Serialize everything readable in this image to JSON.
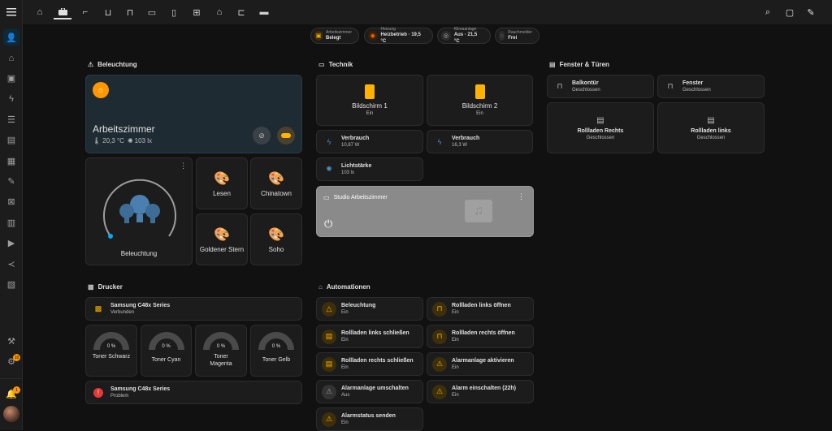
{
  "sidebar": {
    "menu_icon": "menu-icon",
    "items": [
      "person-icon",
      "home-icon",
      "account-box-icon",
      "flash-icon",
      "list-icon",
      "chart-icon",
      "calendar-icon",
      "wrench-icon",
      "hub-icon",
      "server-icon",
      "media-icon",
      "vscode-icon",
      "clipboard-icon"
    ],
    "bottom": [
      "hammer-icon",
      "settings-icon",
      "bell-icon",
      "avatar"
    ],
    "settings_badge": "10",
    "notif_badge": "1"
  },
  "tabs": [
    "home-icon",
    "briefcase-icon",
    "shower-icon",
    "bath-icon",
    "sofa-icon",
    "bed-icon",
    "door-icon",
    "window-icon",
    "garage-icon",
    "car-icon",
    "desk-icon"
  ],
  "top_actions": [
    "search-icon",
    "assist-icon",
    "pencil-icon"
  ],
  "badges": [
    {
      "label": "Arbeitszimmer",
      "value": "Belegt",
      "icon": "briefcase-icon",
      "color": "#ffb300"
    },
    {
      "label": "Heizung",
      "value": "Heizbetrieb · 19,5 °C",
      "icon": "thermostat-icon",
      "color": "#ff6d00"
    },
    {
      "label": "Klimaanlage",
      "value": "Aus · 21,5 °C",
      "icon": "aircon-icon",
      "color": "#9e9e9e"
    },
    {
      "label": "Rauchmelder",
      "value": "Frei",
      "icon": "smoke-icon",
      "color": "#9e9e9e"
    }
  ],
  "sections": {
    "beleuchtung": "Beleuchtung",
    "technik": "Technik",
    "fenster": "Fenster & Türen",
    "drucker": "Drucker",
    "automationen": "Automationen"
  },
  "room": {
    "name": "Arbeitszimmer",
    "temp": "20,3 °C",
    "lux": "103 lx"
  },
  "light_dial": {
    "name": "Beleuchtung"
  },
  "scenes": [
    "Lesen",
    "Chinatown",
    "Goldener Stern",
    "Soho"
  ],
  "technik": {
    "screens": [
      {
        "name": "Bildschirm 1",
        "state": "Ein"
      },
      {
        "name": "Bildschirm 2",
        "state": "Ein"
      }
    ],
    "sensors": [
      {
        "name": "Verbrauch",
        "state": "10,87 W"
      },
      {
        "name": "Verbrauch",
        "state": "16,3 W"
      },
      {
        "name": "Lichtstärke",
        "state": "103 lx"
      }
    ],
    "media": {
      "name": "Studio Arbeitszimmer"
    }
  },
  "fenster": [
    {
      "name": "Balkontür",
      "state": "Geschlossen"
    },
    {
      "name": "Fenster",
      "state": "Geschlossen"
    },
    {
      "name": "Rollladen Rechts",
      "state": "Geschlossen"
    },
    {
      "name": "Rollladen links",
      "state": "Geschlossen"
    }
  ],
  "drucker": {
    "printer": {
      "name": "Samsung C48x Series",
      "state": "Verbunden"
    },
    "toners": [
      {
        "value": "0 %",
        "level": 0,
        "name": "Toner Schwarz"
      },
      {
        "value": "0 %",
        "level": 0,
        "name": "Toner Cyan"
      },
      {
        "value": "0 %",
        "level": 0,
        "name": "Toner Magenta"
      },
      {
        "value": "0 %",
        "level": 0,
        "name": "Toner Gelb"
      }
    ],
    "problem": {
      "name": "Samsung C48x Series",
      "state": "Problem"
    }
  },
  "automationen": [
    {
      "name": "Beleuchtung",
      "state": "Ein",
      "on": true
    },
    {
      "name": "Rollladen links öffnen",
      "state": "Ein",
      "on": true
    },
    {
      "name": "Rollladen links schließen",
      "state": "Ein",
      "on": true
    },
    {
      "name": "Rollladen rechts öffnen",
      "state": "Ein",
      "on": true
    },
    {
      "name": "Rollladen rechts schließen",
      "state": "Ein",
      "on": true
    },
    {
      "name": "Alarmanlage aktivieren",
      "state": "Ein",
      "on": true
    },
    {
      "name": "Alarmanlage umschalten",
      "state": "Aus",
      "on": false
    },
    {
      "name": "Alarm einschalten (22h)",
      "state": "Ein",
      "on": true
    },
    {
      "name": "Alarmstatus senden",
      "state": "Ein",
      "on": true
    }
  ]
}
